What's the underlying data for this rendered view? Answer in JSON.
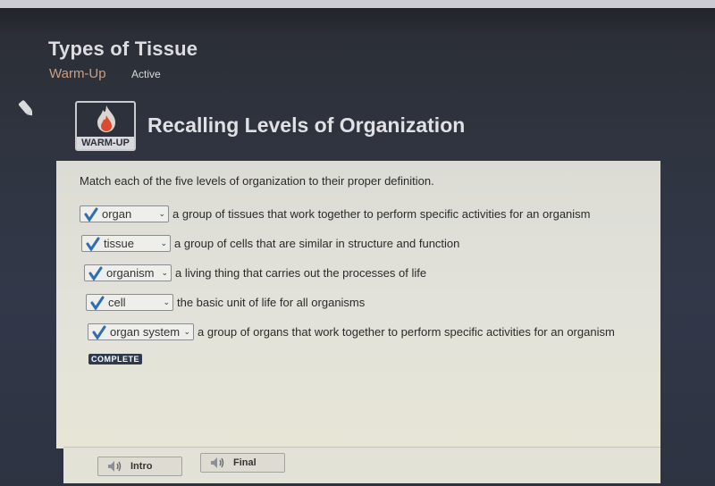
{
  "header": {
    "lesson_title": "Types of Tissue",
    "lesson_type": "Warm-Up",
    "status": "Active"
  },
  "activity": {
    "badge_label": "WARM-UP",
    "title": "Recalling Levels of Organization",
    "instructions": "Match each of the five levels of organization to their proper definition.",
    "rows": [
      {
        "selected": "organ",
        "correct": true,
        "definition": "a group of tissues that work together to perform specific activities for an organism"
      },
      {
        "selected": "tissue",
        "correct": true,
        "definition": "a group of cells that are similar in structure and function"
      },
      {
        "selected": "organism",
        "correct": true,
        "definition": "a living thing that carries out the processes of life"
      },
      {
        "selected": "cell",
        "correct": true,
        "definition": "the basic unit of life for all organisms"
      },
      {
        "selected": "organ system",
        "correct": true,
        "definition": "a group of organs that work together to perform specific activities for an organism"
      }
    ],
    "complete_badge": "COMPLETE"
  },
  "footer": {
    "intro_label": "Intro",
    "final_label": "Final"
  },
  "colors": {
    "check": "#2f6db5",
    "type_accent": "#c8a083",
    "badge_bg": "#2e3a4d"
  }
}
